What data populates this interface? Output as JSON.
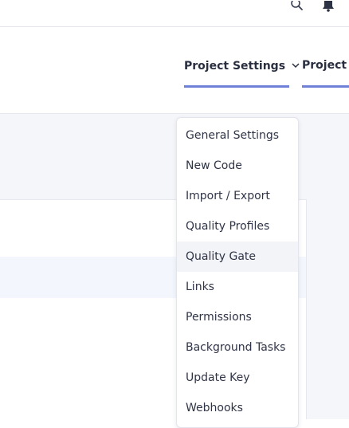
{
  "topbar": {
    "icons": [
      "search-icon",
      "bell-icon"
    ]
  },
  "nav": {
    "tabs": [
      {
        "label": "Project Settings",
        "active": true
      },
      {
        "label": "Project Information",
        "visible_text": "Project In"
      }
    ]
  },
  "dropdown": {
    "items": [
      {
        "label": "General Settings"
      },
      {
        "label": "New Code"
      },
      {
        "label": "Import / Export"
      },
      {
        "label": "Quality Profiles"
      },
      {
        "label": "Quality Gate",
        "hovered": true
      },
      {
        "label": "Links"
      },
      {
        "label": "Permissions"
      },
      {
        "label": "Background Tasks"
      },
      {
        "label": "Update Key"
      },
      {
        "label": "Webhooks"
      }
    ]
  },
  "colors": {
    "accent": "#6f80d8",
    "text": "#2a2f40",
    "background": "#f5f6fa"
  }
}
